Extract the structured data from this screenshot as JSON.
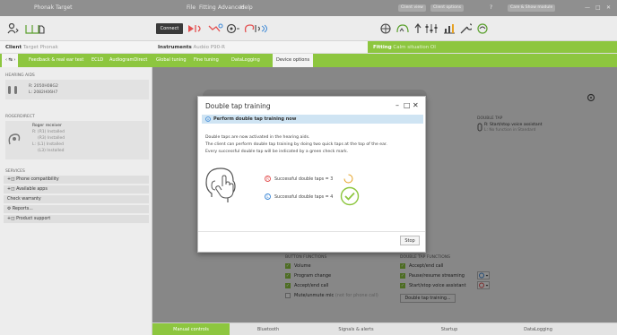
{
  "window": {
    "title": "Phonak Target",
    "menu": [
      "File",
      "Fitting",
      "Advanced",
      "Help"
    ],
    "right_pills": [
      "Client view",
      "Client options",
      "Care & Show module"
    ],
    "controls": [
      "?",
      "—",
      "□",
      "✕"
    ]
  },
  "toolbar": {
    "connect_label": "Connect"
  },
  "context": {
    "client_label": "Client",
    "client_value": "Target Phonak",
    "instruments_label": "Instruments",
    "instruments_value": "Audéo P90-R",
    "fitting_label": "Fitting",
    "fitting_value": "Calm situation OI"
  },
  "tabs": [
    "Feedback & real ear test",
    "ECLD",
    "AudiogramDirect",
    "Global tuning",
    "Fine tuning",
    "DataLogging",
    "Device options"
  ],
  "left": {
    "hearing_aids_title": "HEARING AIDS",
    "hearing_aid_r": "R: 2050H08G2",
    "hearing_aid_l": "L: 2082H06H7",
    "roger_title": "ROGERDIRECT",
    "roger_receiver": "Roger receiver",
    "roger_r_installed": "R: (R1) Installed",
    "roger_r_installed2": "(R3) Installed",
    "roger_l_installed": "L: (L1) Installed",
    "roger_l_installed2": "(L3) Installed",
    "services_title": "SERVICES",
    "services": [
      "Phone compatibility",
      "Available apps",
      "Check warranty",
      "Reports...",
      "Product support"
    ]
  },
  "main": {
    "double_tap_title": "DOUBLE TAP",
    "double_tap_r": "R: Start/stop voice assistant",
    "double_tap_l": "L: No function in Standard",
    "mid_label": "Connect",
    "button_functions_title": "BUTTON FUNCTIONS",
    "button_functions": [
      "Volume",
      "Program change",
      "Accept/end call",
      "Mute/unmute mic"
    ],
    "mute_note": "(not for phone call)",
    "double_tap_functions_title": "DOUBLE TAP FUNCTIONS",
    "double_tap_functions": [
      "Accept/end call",
      "Pause/resume streaming",
      "Start/stop voice assistant"
    ],
    "double_tap_training_button": "Double tap training..."
  },
  "bottom_tabs": [
    "Manual controls",
    "Bluetooth",
    "Signals & alerts",
    "Startup",
    "DataLogging"
  ],
  "dialog": {
    "title": "Double tap training",
    "banner": "Perform double tap training now",
    "line1": "Double taps are now activated in the hearing aids.",
    "line2": "The client can perform double tap training by doing two quick taps at the top of the ear.",
    "line3": "Every successful double tap will be indicated by a green check mark.",
    "status_r": "Successful double taps = 3",
    "status_l": "Successful double taps = 4",
    "stop_label": "Stop"
  },
  "colors": {
    "accent_green": "#8dc63f",
    "banner_blue": "#cfe4f3",
    "right_red": "#e35050",
    "left_blue": "#3b87d6"
  }
}
